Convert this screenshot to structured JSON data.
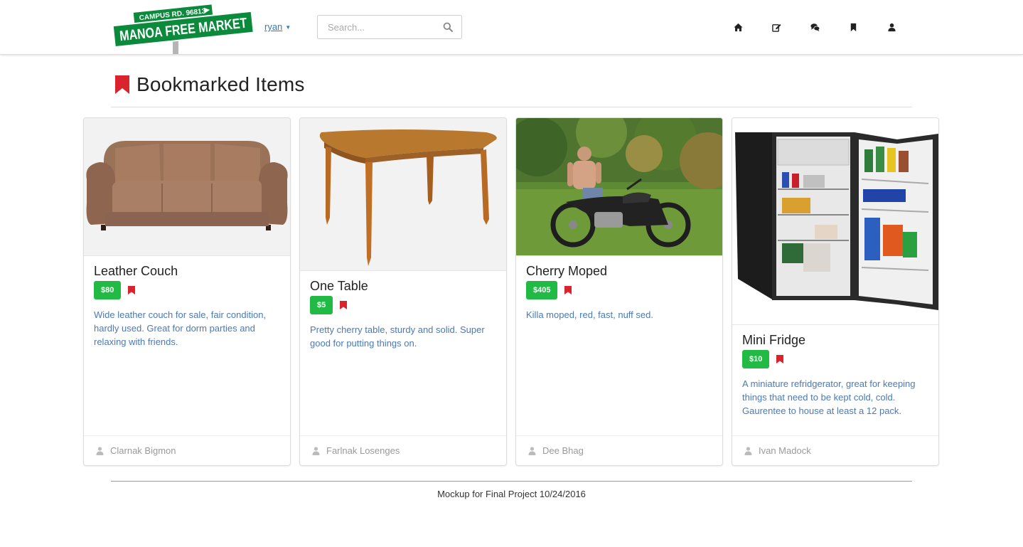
{
  "nav": {
    "logo_line1": "CAMPUS RD. 96813",
    "logo_line2": "MANOA FREE MARKET",
    "user": "ryan",
    "search_placeholder": "Search...",
    "icons": [
      "home-icon",
      "edit-icon",
      "comments-icon",
      "bookmark-icon",
      "user-icon"
    ]
  },
  "page": {
    "title": "Bookmarked Items"
  },
  "items": [
    {
      "name": "Leather Couch",
      "price": "$80",
      "description": "Wide leather couch for sale, fair condition, hardly used. Great for dorm parties and relaxing with friends.",
      "seller": "Clarnak Bigmon"
    },
    {
      "name": "One Table",
      "price": "$5",
      "description": "Pretty cherry table, sturdy and solid. Super good for putting things on.",
      "seller": "Farlnak Losenges"
    },
    {
      "name": "Cherry Moped",
      "price": "$405",
      "description": "Killa moped, red, fast, nuff sed.",
      "seller": "Dee Bhag"
    },
    {
      "name": "Mini Fridge",
      "price": "$10",
      "description": "A miniature refridgerator, great for keeping things that need to be kept cold, cold. Gaurentee to house at least a 12 pack.",
      "seller": "Ivan Madock"
    }
  ],
  "footer": {
    "text": "Mockup for Final Project 10/24/2016"
  },
  "colors": {
    "accent_red": "#d9232d",
    "price_green": "#21ba45",
    "link_blue": "#337ab7",
    "logo_green": "#0b8a3c"
  }
}
